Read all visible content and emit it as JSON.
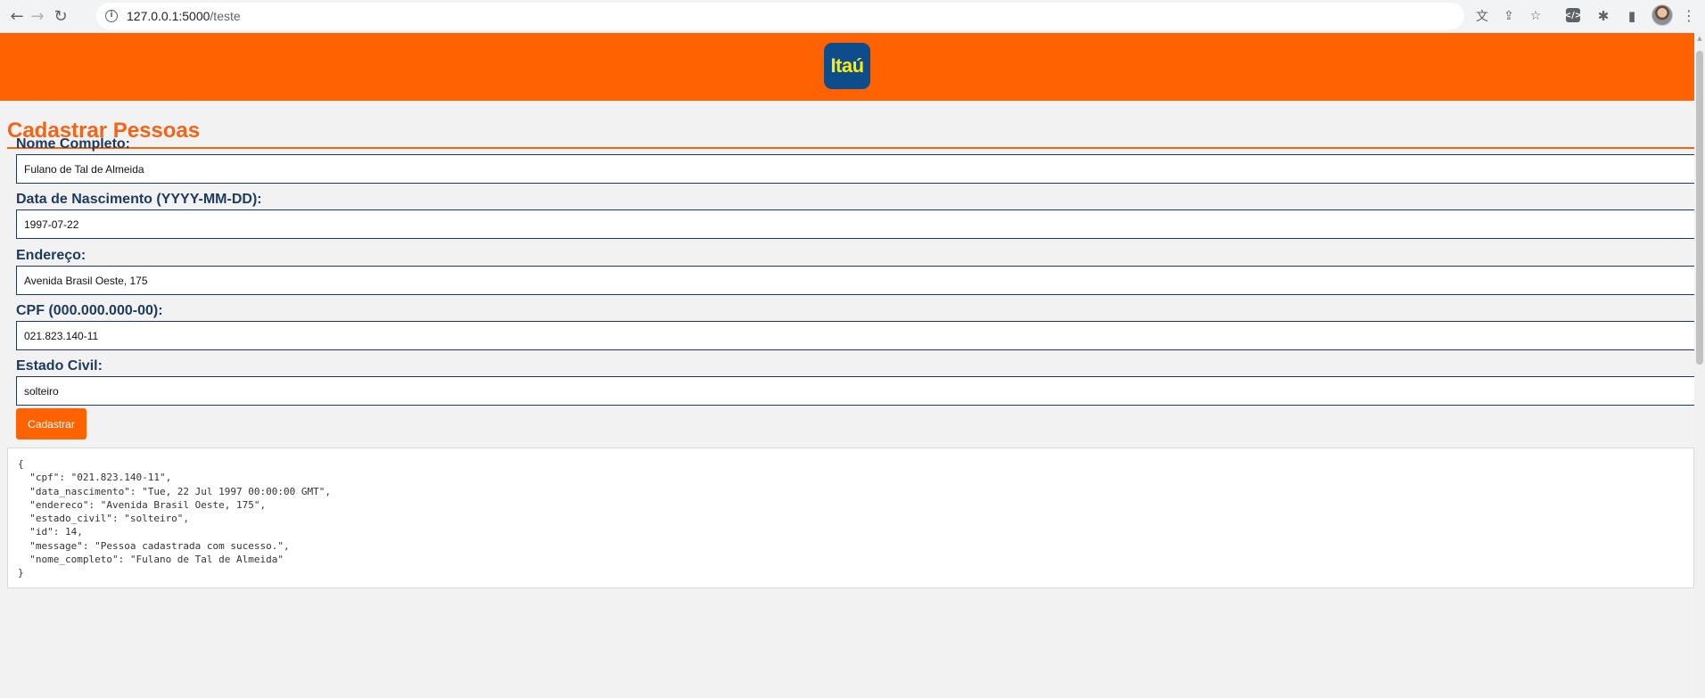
{
  "browser": {
    "url_host": "127.0.0.1:5000",
    "url_path": "/teste",
    "back_icon": "←",
    "forward_icon": "→",
    "reload_icon": "↻",
    "info_icon": "i",
    "translate_icon": "文",
    "share_icon": "⇪",
    "bookmark_icon": "☆",
    "devtools_ext_icon": "</>",
    "extensions_icon": "✱",
    "sidepanel_icon": "▮",
    "menu_icon": "⋮"
  },
  "header": {
    "brand_color": "#ff6200",
    "logo_text": "Itaú"
  },
  "form": {
    "title": "Cadastrar Pessoas",
    "fields": [
      {
        "label": "Nome Completo:",
        "value": "Fulano de Tal de Almeida"
      },
      {
        "label": "Data de Nascimento (YYYY-MM-DD):",
        "value": "1997-07-22"
      },
      {
        "label": "Endereço:",
        "value": "Avenida Brasil Oeste, 175"
      },
      {
        "label": "CPF (000.000.000-00):",
        "value": "021.823.140-11"
      },
      {
        "label": "Estado Civil:",
        "value": "solteiro"
      }
    ],
    "submit_label": "Cadastrar"
  },
  "result": {
    "text": "{\n  \"cpf\": \"021.823.140-11\",\n  \"data_nascimento\": \"Tue, 22 Jul 1997 00:00:00 GMT\",\n  \"endereco\": \"Avenida Brasil Oeste, 175\",\n  \"estado_civil\": \"solteiro\",\n  \"id\": 14,\n  \"message\": \"Pessoa cadastrada com sucesso.\",\n  \"nome_completo\": \"Fulano de Tal de Almeida\"\n}"
  }
}
